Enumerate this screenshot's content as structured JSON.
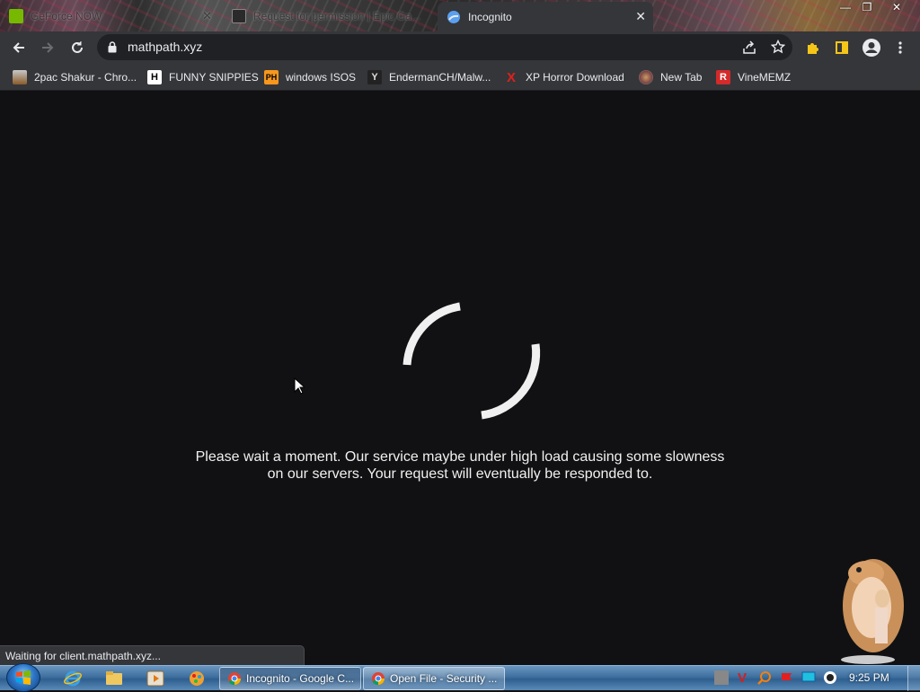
{
  "browser": {
    "tabs": [
      {
        "title": "GeForce NOW",
        "favicon": "geforce-now-favicon",
        "active": false
      },
      {
        "title": "Request for permission | Epic Ga...",
        "favicon": "epic-games-favicon",
        "active": false
      },
      {
        "title": "Incognito",
        "favicon": "chrome-favicon",
        "active": true
      }
    ],
    "address": "mathpath.xyz",
    "bookmarks": [
      {
        "label": "2pac Shakur - Chro...",
        "icon": "2pac-favicon"
      },
      {
        "label": "FUNNY SNIPPIES",
        "icon": "H",
        "icon_name": "h-logo-favicon"
      },
      {
        "label": "windows ISOS",
        "icon": "PH",
        "icon_name": "ph-logo-favicon",
        "color": "#f7971d"
      },
      {
        "label": "EndermanCH/Malw...",
        "icon": "Y",
        "icon_name": "endermanch-favicon"
      },
      {
        "label": "XP Horror Download",
        "icon": "X",
        "icon_name": "x-logo-favicon",
        "color": "#e0201b"
      },
      {
        "label": "New Tab",
        "icon": "globe-favicon"
      },
      {
        "label": "VineMEMZ",
        "icon": "R",
        "icon_name": "r-logo-favicon",
        "color": "#d32a2a"
      }
    ]
  },
  "page": {
    "message_line1": "Please wait a moment. Our service maybe under high load causing some slowness",
    "message_line2": "on our servers. Your request will eventually be responded to.",
    "spinner": "loading-spinner"
  },
  "status_bar": "Waiting for client.mathpath.xyz...",
  "taskbar": {
    "tasks": [
      {
        "label": "Incognito - Google C...",
        "icon": "chrome-icon",
        "pressed": true
      },
      {
        "label": "Open File - Security ...",
        "icon": "chrome-icon",
        "pressed": false
      }
    ],
    "clock": "9:25 PM"
  },
  "colors": {
    "content_bg": "#111113",
    "toolbar_bg": "#35363a",
    "omnibox_bg": "#202124",
    "text": "#e8eaed"
  }
}
